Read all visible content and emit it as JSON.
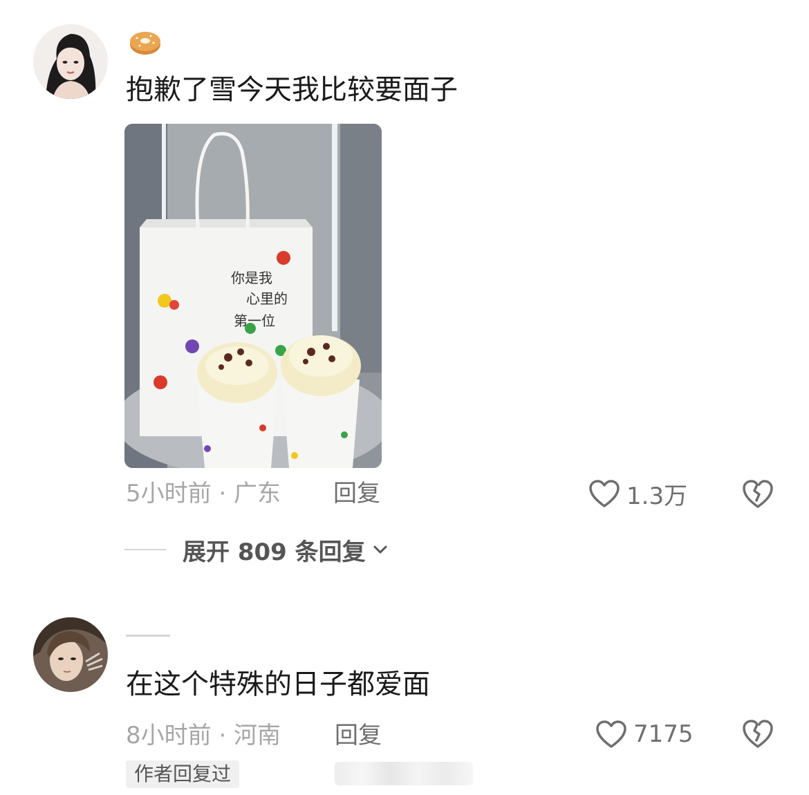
{
  "comments": [
    {
      "avatar_icon": "user-avatar-woman",
      "badge_icon": "bagel-emoji-icon",
      "text": "抱歉了雪今天我比较要面子",
      "image": {
        "icon": "milk-tea-bag-photo",
        "bag_text": [
          "你是我",
          "心里的",
          "第一位"
        ]
      },
      "meta": "5小时前 · 广东",
      "reply_label": "回复",
      "like_count": "1.3万",
      "like_icon": "heart-outline-icon",
      "dislike_icon": "broken-heart-icon",
      "expand_label": "展开 809 条回复",
      "expand_icon": "chevron-down-icon"
    },
    {
      "avatar_icon": "user-avatar-man",
      "text": "在这个特殊的日子都爱面",
      "meta": "8小时前 · 河南",
      "reply_label": "回复",
      "like_count": "7175",
      "like_icon": "heart-outline-icon",
      "dislike_icon": "broken-heart-icon",
      "author_badge": "作者回复过"
    }
  ]
}
